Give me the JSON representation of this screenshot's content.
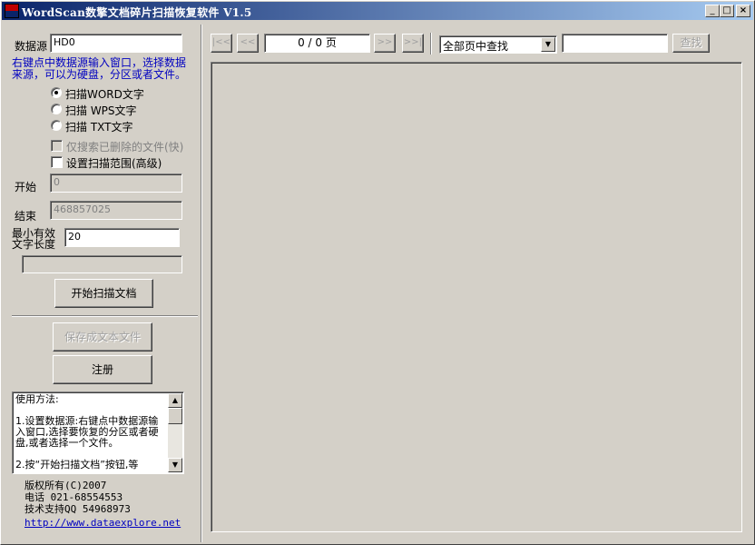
{
  "window": {
    "title": "WordScan数擎文档碎片扫描恢复软件 V1.5",
    "minimize": "_",
    "maximize": "□",
    "close": "×"
  },
  "left": {
    "datasource_label": "数据源",
    "datasource_value": "HD0",
    "hint": "右键点中数据源输入窗口，选择数据来源，可以为硬盘，分区或者文件。",
    "radios": [
      {
        "label": "扫描WORD文字",
        "checked": true
      },
      {
        "label": "扫描 WPS文字",
        "checked": false
      },
      {
        "label": "扫描 TXT文字",
        "checked": false
      }
    ],
    "check_deleted_only": "仅搜索已删除的文件(快)",
    "check_range": "设置扫描范围(高级)",
    "start_label": "开始",
    "start_value": "0",
    "end_label": "结束",
    "end_value": "468857025",
    "minlen_label": "最小有效文字长度",
    "minlen_value": "20",
    "scan_button": "开始扫描文档",
    "save_button": "保存成文本文件",
    "register_button": "注册",
    "usage_text": "使用方法:\n\n1.设置数据源:右键点中数据源输入窗口,选择要恢复的分区或者硬盘,或者选择一个文件。\n\n2.按“开始扫描文档”按钮,等",
    "copyright": "版权所有(C)2007",
    "phone": "电话 021-68554553",
    "support_qq": "技术支持QQ 54968973",
    "website": "http://www.dataexplore.net"
  },
  "toolbar": {
    "first": "|<<",
    "prev": "<<",
    "page_indicator": "0 / 0 页",
    "next": ">>",
    "last": ">>|",
    "search_scope": "全部页中查找",
    "search_value": "",
    "search_button": "查找"
  }
}
